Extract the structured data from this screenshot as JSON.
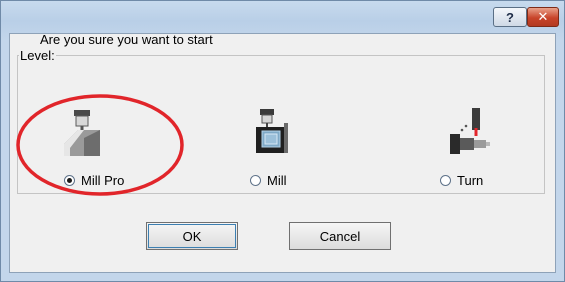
{
  "window": {
    "help_glyph": "?",
    "close_glyph": "✕"
  },
  "prompt_text": "Are you sure you want to start",
  "group": {
    "label": "Level:",
    "options": [
      {
        "label": "Mill Pro",
        "icon": "mill-pro-machine-icon",
        "selected": true
      },
      {
        "label": "Mill",
        "icon": "mill-machine-icon",
        "selected": false
      },
      {
        "label": "Turn",
        "icon": "lathe-turn-icon",
        "selected": false
      }
    ]
  },
  "buttons": {
    "ok_label": "OK",
    "cancel_label": "Cancel"
  },
  "colors": {
    "annotation": "#e1252a",
    "title_gradient": "#c7daee",
    "client_bg": "#f0f0f0"
  }
}
